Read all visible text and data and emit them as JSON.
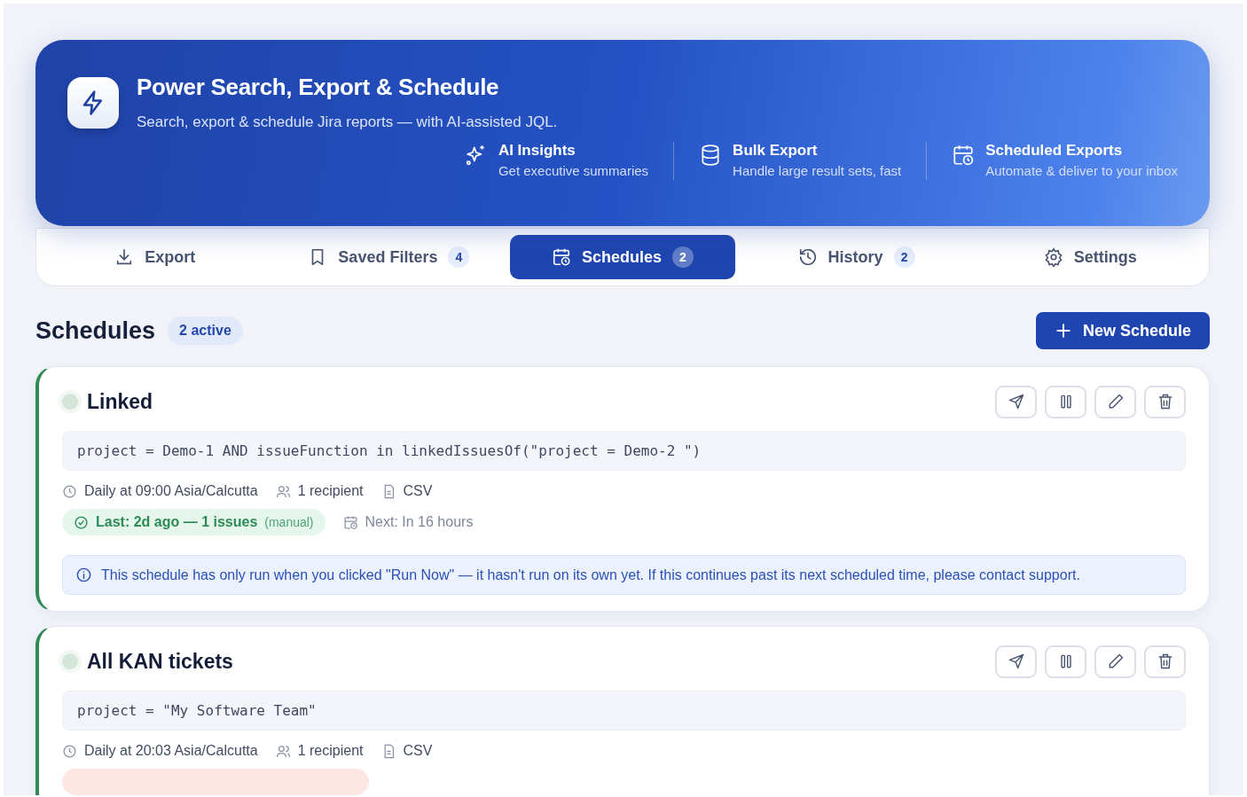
{
  "header": {
    "title": "Power Search, Export & Schedule",
    "subtitle": "Search, export & schedule Jira reports — with AI-assisted JQL.",
    "features": [
      {
        "kind": "sparkles",
        "title": "AI Insights",
        "text": "Get executive summaries"
      },
      {
        "kind": "database",
        "title": "Bulk Export",
        "text": "Handle large result sets, fast"
      },
      {
        "kind": "calendar",
        "title": "Scheduled Exports",
        "text": "Automate & deliver to your inbox"
      }
    ]
  },
  "tabs": [
    {
      "kind": "download",
      "label": "Export",
      "selected": false
    },
    {
      "kind": "bookmark",
      "label": "Saved Filters",
      "count": "4",
      "selected": false
    },
    {
      "kind": "calendar",
      "label": "Schedules",
      "count": "2",
      "selected": true
    },
    {
      "kind": "history",
      "label": "History",
      "count": "2",
      "selected": false
    },
    {
      "kind": "gear",
      "label": "Settings",
      "selected": false
    }
  ],
  "section": {
    "title": "Schedules",
    "badge": "2 active",
    "new_button": "New Schedule"
  },
  "schedules": [
    {
      "name": "Linked",
      "active": true,
      "query": "project = Demo-1 AND issueFunction in linkedIssuesOf(\"project = Demo-2 \")",
      "frequency": "Daily at 09:00 Asia/Calcutta",
      "recipients": "1 recipient",
      "format": "CSV",
      "last_run": {
        "kind": "success",
        "text": "Last: 2d ago — 1 issues",
        "note": "(manual)"
      },
      "next": "Next: In 16 hours",
      "notice": "This schedule has only run when you clicked \"Run Now\" — it hasn't run on its own yet. If this continues past its next scheduled time, please contact support."
    },
    {
      "name": "All KAN tickets",
      "active": true,
      "query": "project = \"My Software Team\"",
      "frequency": "Daily at 20:03 Asia/Calcutta",
      "recipients": "1 recipient",
      "format": "CSV",
      "last_run": {
        "kind": "failed"
      }
    }
  ]
}
